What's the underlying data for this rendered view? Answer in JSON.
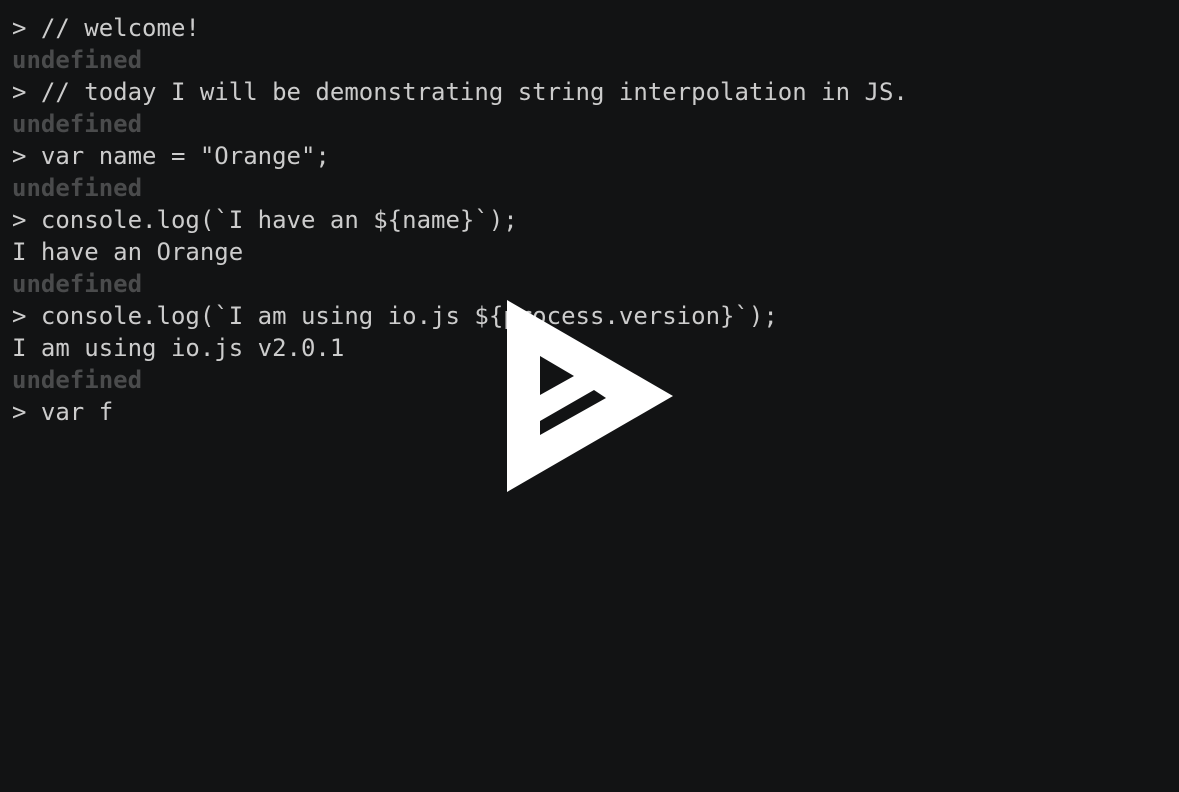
{
  "terminal": {
    "lines": [
      {
        "kind": "input",
        "text": "> // welcome!"
      },
      {
        "kind": "undefined",
        "text": "undefined"
      },
      {
        "kind": "input",
        "text": "> // today I will be demonstrating string interpolation in JS."
      },
      {
        "kind": "undefined",
        "text": "undefined"
      },
      {
        "kind": "input",
        "text": "> var name = \"Orange\";"
      },
      {
        "kind": "undefined",
        "text": "undefined"
      },
      {
        "kind": "input",
        "text": "> console.log(`I have an ${name}`);"
      },
      {
        "kind": "output",
        "text": "I have an Orange"
      },
      {
        "kind": "undefined",
        "text": "undefined"
      },
      {
        "kind": "input",
        "text": "> console.log(`I am using io.js ${process.version}`);"
      },
      {
        "kind": "output",
        "text": "I am using io.js v2.0.1"
      },
      {
        "kind": "undefined",
        "text": "undefined"
      },
      {
        "kind": "input",
        "text": "> var f"
      }
    ]
  },
  "overlay": {
    "icon": "asciinema-play-icon",
    "color": "#ffffff"
  },
  "colors": {
    "background": "#121314",
    "text": "#cccccc",
    "dim": "#4a4b4c"
  }
}
